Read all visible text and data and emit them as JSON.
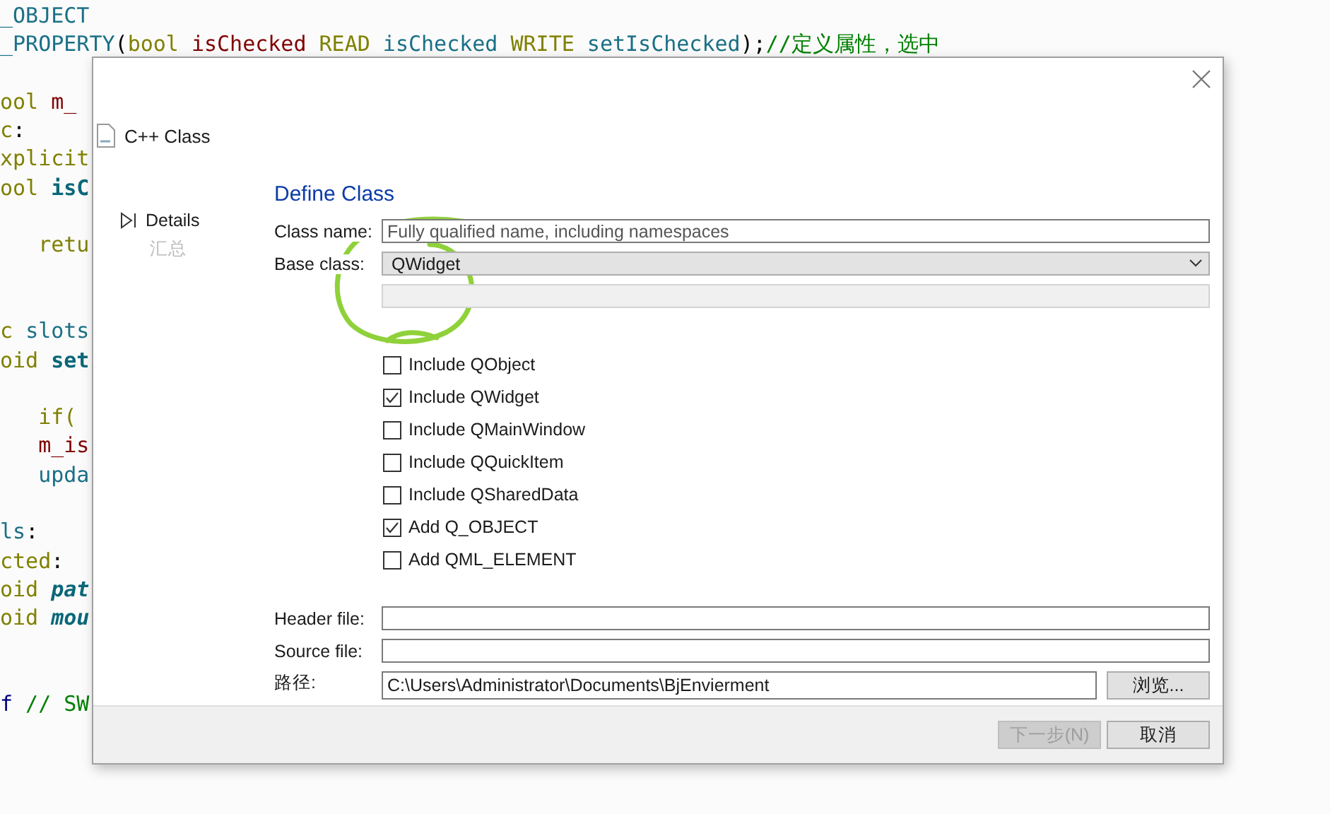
{
  "editor": {
    "lines": [
      {
        "kind": "code",
        "tokens": [
          {
            "text": "_OBJECT",
            "kind": "macro"
          }
        ]
      },
      {
        "kind": "code",
        "tokens": [
          {
            "text": "_PROPERTY",
            "kind": "macro"
          },
          {
            "text": "(",
            "kind": "punct"
          },
          {
            "text": "bool",
            "kind": "keyword"
          },
          {
            "text": " isChecked",
            "kind": "member"
          },
          {
            "text": " READ",
            "kind": "keyword"
          },
          {
            "text": " isChecked",
            "kind": "macro"
          },
          {
            "text": " WRITE",
            "kind": "keyword"
          },
          {
            "text": " setIsChecked",
            "kind": "macro"
          },
          {
            "text": ");",
            "kind": "punct"
          },
          {
            "text": "//定义属性，选中",
            "kind": "comment"
          }
        ]
      },
      {
        "kind": "blank"
      },
      {
        "kind": "code",
        "tokens": [
          {
            "text": "ool ",
            "kind": "keyword"
          },
          {
            "text": "m_",
            "kind": "member"
          }
        ]
      },
      {
        "kind": "code",
        "tokens": [
          {
            "text": "c",
            "kind": "keyword"
          },
          {
            "text": ":",
            "kind": "punct"
          }
        ]
      },
      {
        "kind": "code",
        "tokens": [
          {
            "text": "xplicit",
            "kind": "keyword"
          }
        ]
      },
      {
        "kind": "code",
        "tokens": [
          {
            "text": "ool ",
            "kind": "keyword"
          },
          {
            "text": "isC",
            "kind": "method"
          }
        ]
      },
      {
        "kind": "blank"
      },
      {
        "kind": "code",
        "tokens": [
          {
            "text": "   retu",
            "kind": "keyword"
          }
        ]
      },
      {
        "kind": "blank"
      },
      {
        "kind": "blank"
      },
      {
        "kind": "code",
        "tokens": [
          {
            "text": "c ",
            "kind": "keyword"
          },
          {
            "text": "slots",
            "kind": "macro"
          }
        ]
      },
      {
        "kind": "code",
        "tokens": [
          {
            "text": "oid ",
            "kind": "keyword"
          },
          {
            "text": "set",
            "kind": "method"
          }
        ]
      },
      {
        "kind": "blank"
      },
      {
        "kind": "code",
        "tokens": [
          {
            "text": "   if(",
            "kind": "keyword"
          }
        ]
      },
      {
        "kind": "code",
        "tokens": [
          {
            "text": "   m_is",
            "kind": "member"
          }
        ]
      },
      {
        "kind": "code",
        "tokens": [
          {
            "text": "   upda",
            "kind": "macro"
          }
        ]
      },
      {
        "kind": "blank"
      },
      {
        "kind": "code",
        "tokens": [
          {
            "text": "ls",
            "kind": "macro"
          },
          {
            "text": ":",
            "kind": "punct"
          }
        ]
      },
      {
        "kind": "code",
        "tokens": [
          {
            "text": "cted",
            "kind": "keyword"
          },
          {
            "text": ":",
            "kind": "punct"
          }
        ]
      },
      {
        "kind": "code",
        "tokens": [
          {
            "text": "oid ",
            "kind": "keyword"
          },
          {
            "text": "pat",
            "kind": "italic-method"
          }
        ]
      },
      {
        "kind": "code",
        "tokens": [
          {
            "text": "oid ",
            "kind": "keyword"
          },
          {
            "text": "mou",
            "kind": "italic-method"
          }
        ]
      },
      {
        "kind": "blank"
      },
      {
        "kind": "blank"
      },
      {
        "kind": "code",
        "tokens": [
          {
            "text": "f",
            "kind": "preproc"
          },
          {
            "text": " // SW",
            "kind": "comment"
          }
        ]
      }
    ]
  },
  "dialog": {
    "title": "C++ Class",
    "steps": [
      {
        "label": "Details",
        "selected": true
      },
      {
        "label": "汇总",
        "selected": false
      }
    ],
    "heading": "Define Class",
    "class_name": {
      "label": "Class name:",
      "placeholder": "Fully qualified name, including namespaces"
    },
    "base_class": {
      "label": "Base class:",
      "value": "QWidget"
    },
    "options": [
      {
        "label": "Include QObject",
        "checked": false
      },
      {
        "label": "Include QWidget",
        "checked": true
      },
      {
        "label": "Include QMainWindow",
        "checked": false
      },
      {
        "label": "Include QQuickItem",
        "checked": false
      },
      {
        "label": "Include QSharedData",
        "checked": false
      },
      {
        "label": "Add Q_OBJECT",
        "checked": true
      },
      {
        "label": "Add QML_ELEMENT",
        "checked": false
      }
    ],
    "header_file": {
      "label": "Header file:"
    },
    "source_file": {
      "label": "Source file:"
    },
    "path": {
      "label": "路径:",
      "value": "C:\\Users\\Administrator\\Documents\\BjEnvierment"
    },
    "browse_button": {
      "label": "浏览...",
      "disabled": false
    },
    "buttons": [
      {
        "label": "下一步(N)",
        "disabled": true
      },
      {
        "label": "取消",
        "disabled": false
      }
    ]
  }
}
